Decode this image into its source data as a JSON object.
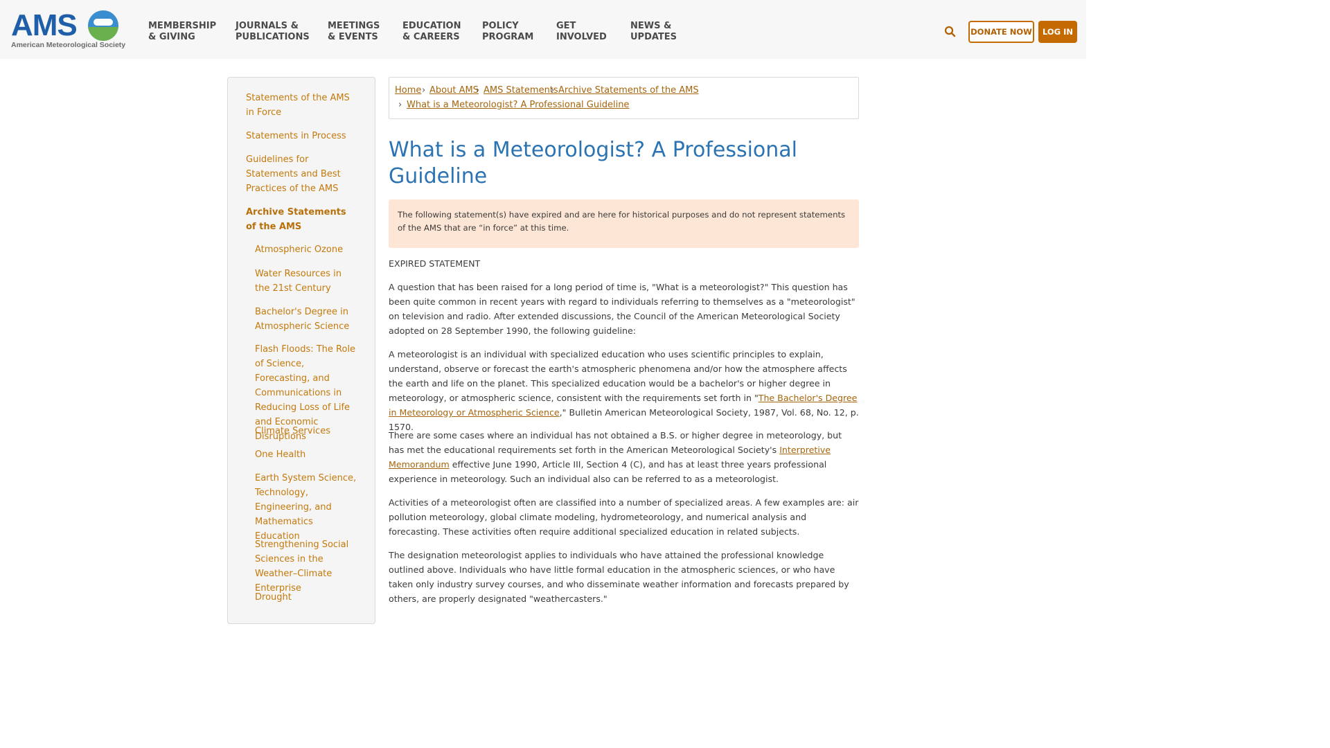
{
  "header": {
    "logo_text": "AMS",
    "logo_subtitle": "American Meteorological Society",
    "nav": [
      {
        "line1": "MEMBERSHIP",
        "line2": "& GIVING"
      },
      {
        "line1": "JOURNALS &",
        "line2": "PUBLICATIONS"
      },
      {
        "line1": "MEETINGS",
        "line2": "& EVENTS"
      },
      {
        "line1": "EDUCATION",
        "line2": "& CAREERS"
      },
      {
        "line1": "POLICY",
        "line2": "PROGRAM"
      },
      {
        "line1": "GET",
        "line2": "INVOLVED"
      },
      {
        "line1": "NEWS &",
        "line2": "UPDATES"
      }
    ],
    "search_icon": "search-icon",
    "donate_label": "DONATE NOW",
    "login_label": "LOG IN"
  },
  "sidebar": {
    "items": [
      {
        "label": "Statements of the AMS in Force"
      },
      {
        "label": "Statements in Process"
      },
      {
        "label": "Guidelines for Statements and Best Practices of the AMS"
      },
      {
        "label": "Archive Statements of the AMS"
      }
    ],
    "subitems": [
      {
        "label": "Atmospheric Ozone"
      },
      {
        "label": "Water Resources in the 21st Century"
      },
      {
        "label": "Bachelor's Degree in Atmospheric Science"
      },
      {
        "label": "Flash Floods: The Role of Science, Forecasting, and Communications in Reducing Loss of Life and Economic Disruptions"
      },
      {
        "label": "Climate Services"
      },
      {
        "label": "One Health"
      },
      {
        "label": "Earth System Science, Technology, Engineering, and Mathematics Education"
      },
      {
        "label": "Strengthening Social Sciences in the Weather–Climate Enterprise"
      },
      {
        "label": "Drought"
      }
    ]
  },
  "breadcrumb": {
    "items": [
      "Home",
      "About AMS",
      "AMS Statements",
      "Archive Statements of the AMS",
      "What is a Meteorologist? A Professional Guideline"
    ],
    "separator": "›"
  },
  "page": {
    "title": "What is a Meteorologist? A Professional Guideline",
    "notice": "The following statement(s) have expired and are here for historical purposes and do not represent statements of the AMS that are “in force” at this time.",
    "expired_label": "EXPIRED STATEMENT",
    "p1": "A question that has been raised for a long period of time is, \"What is a meteorologist?\" This question has been quite common in recent years with regard to individuals referring to themselves as a \"meteorologist\" on television and radio. After extended discussions, the Council of the American Meteorological Society adopted on 28 September 1990, the following guideline:",
    "p2_before": "A meteorologist is an individual with specialized education who uses scientific principles to explain, understand, observe or forecast the earth's atmospheric phenomena and/or how the atmosphere affects the earth and life on the planet. This specialized education would be a bachelor's or higher degree in meteorology, or atmospheric science, consistent with the requirements set forth in \"",
    "p2_link": "The Bachelor's Degree in Meteorology or Atmospheric Science",
    "p2_after": ",\" Bulletin American Meteorological Society, 1987, Vol. 68, No. 12, p. 1570.",
    "p3_before": "There are some cases where an individual has not obtained a B.S. or higher degree in meteorology, but has met the educational requirements set forth in the American Meteorological Society's ",
    "p3_link": "Interpretive Memorandum",
    "p3_after": " effective June 1990, Article III, Section 4 (C), and has at least three years professional experience in meteorology. Such an individual also can be referred to as a meteorologist.",
    "p4": "Activities of a meteorologist often are classified into a number of specialized areas. A few examples are: air pollution meteorology, global climate modeling, hydrometeorology, and numerical analysis and forecasting. These activities often require additional specialized education in related subjects.",
    "p5": "The designation meteorologist applies to individuals who have attained the professional knowledge outlined above. Individuals who have little formal education in the atmospheric sciences, or who have taken only industry survey courses, and who disseminate weather information and forecasts prepared by others, are properly designated \"weathercasters.\""
  },
  "colors": {
    "accent": "#c46a00",
    "link": "#a5650c",
    "title": "#2b73b2",
    "notice_bg": "#fde6d6"
  }
}
